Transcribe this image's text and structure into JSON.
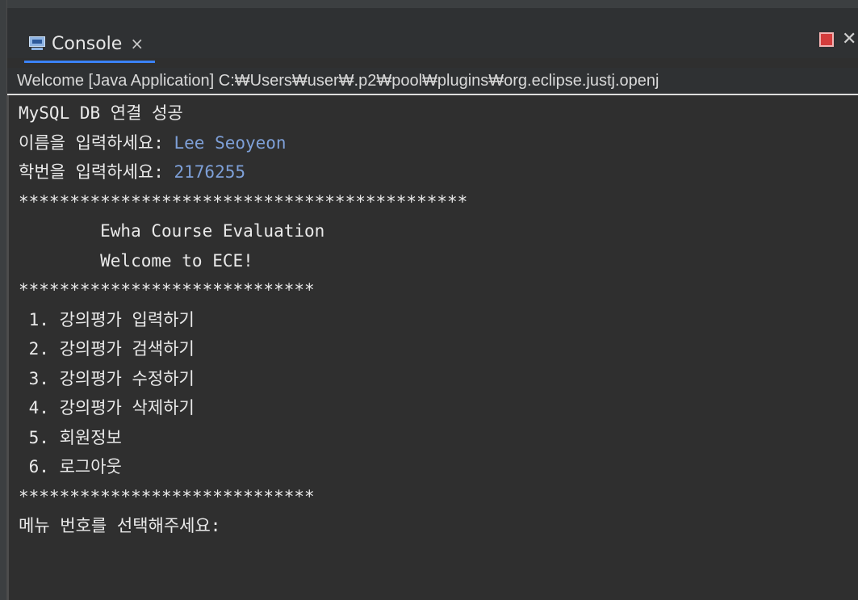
{
  "tab": {
    "title": "Console",
    "close": "×"
  },
  "launch": "Welcome [Java Application] C:₩Users₩user₩.p2₩pool₩plugins₩org.eclipse.justj.openj",
  "console": {
    "lines": [
      {
        "prompt": "MySQL DB 연결 성공",
        "input": ""
      },
      {
        "prompt": "이름을 입력하세요: ",
        "input": "Lee Seoyeon"
      },
      {
        "prompt": "학번을 입력하세요: ",
        "input": "2176255"
      },
      {
        "prompt": "********************************************",
        "input": ""
      },
      {
        "prompt": "        Ewha Course Evaluation",
        "input": ""
      },
      {
        "prompt": "        Welcome to ECE!",
        "input": ""
      },
      {
        "prompt": "*****************************",
        "input": ""
      },
      {
        "prompt": " 1. 강의평가 입력하기",
        "input": ""
      },
      {
        "prompt": " 2. 강의평가 검색하기",
        "input": ""
      },
      {
        "prompt": " 3. 강의평가 수정하기",
        "input": ""
      },
      {
        "prompt": " 4. 강의평가 삭제하기",
        "input": ""
      },
      {
        "prompt": " 5. 회원정보",
        "input": ""
      },
      {
        "prompt": " 6. 로그아웃",
        "input": ""
      },
      {
        "prompt": "*****************************",
        "input": ""
      },
      {
        "prompt": "메뉴 번호를 선택해주세요:",
        "input": ""
      }
    ]
  },
  "icons": {
    "tab_icon": "console-icon",
    "terminate": "stop-icon",
    "remove": "close-icon"
  },
  "colors": {
    "background": "#2f2f2f",
    "text": "#eaeaea",
    "user_input": "#7ea0d8",
    "tab_accent": "#3b82f6",
    "terminate": "#d43c3c"
  }
}
